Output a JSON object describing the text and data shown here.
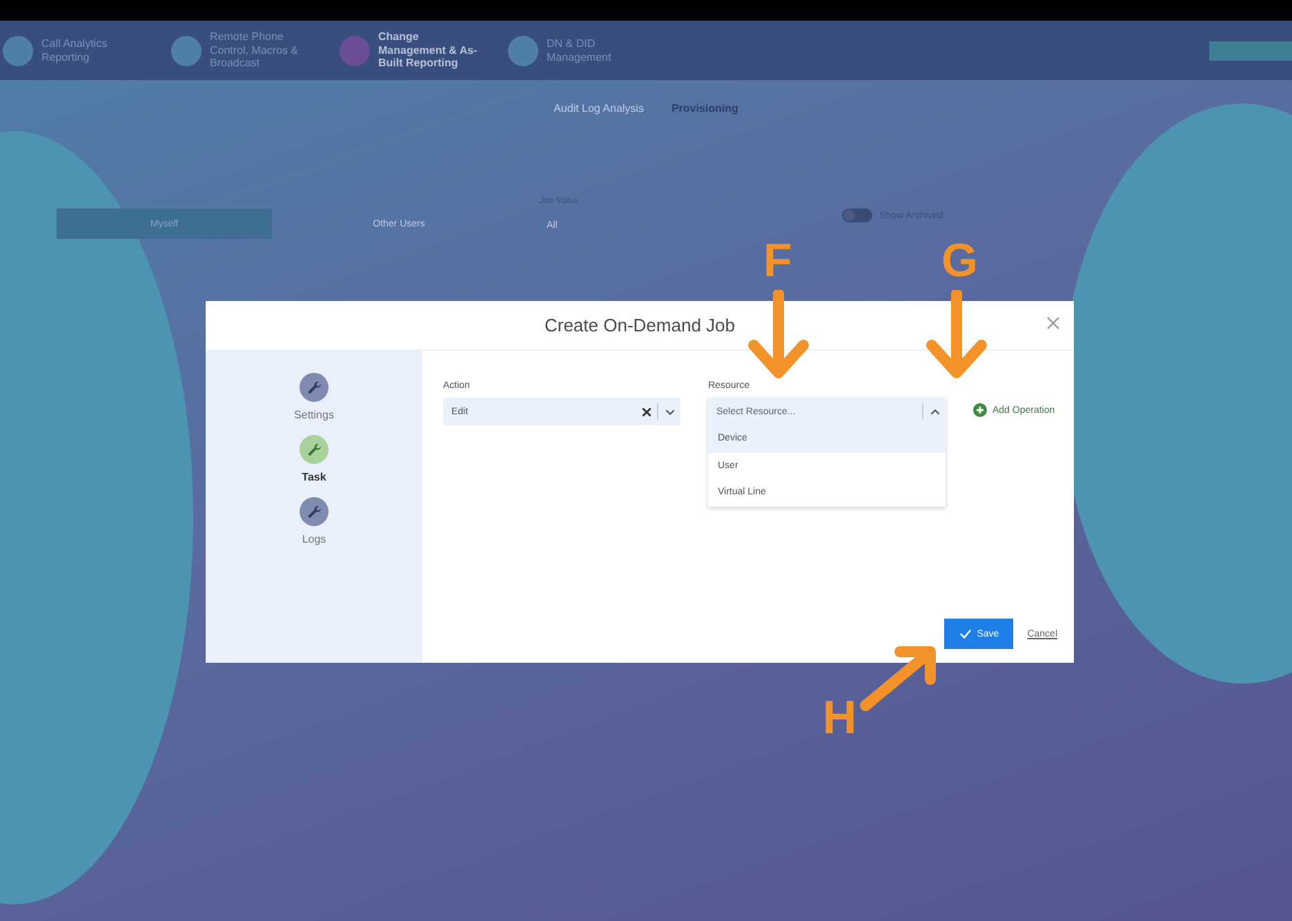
{
  "app_nav": {
    "items": [
      {
        "label": "Call Analytics Reporting",
        "selected": false
      },
      {
        "label": "Remote Phone Control, Macros & Broadcast",
        "selected": false
      },
      {
        "label": "Change Management & As-Built Reporting",
        "selected": true
      },
      {
        "label": "DN & DID Management",
        "selected": false
      }
    ]
  },
  "page_tabs": [
    {
      "label": "Audit Log Analysis",
      "selected": false
    },
    {
      "label": "Provisioning",
      "selected": true
    }
  ],
  "filters": {
    "owner_buttons": [
      {
        "label": "Myself",
        "selected": true
      },
      {
        "label": "Other Users",
        "selected": false
      }
    ],
    "job_status_label": "Job Status",
    "job_status_value": "All",
    "show_archived": {
      "label": "Show Archived",
      "on": false
    }
  },
  "dialog": {
    "title": "Create On-Demand Job",
    "steps": [
      {
        "label": "Settings",
        "selected": false
      },
      {
        "label": "Task",
        "selected": true
      },
      {
        "label": "Logs",
        "selected": false
      }
    ],
    "action": {
      "label": "Action",
      "value": "Edit"
    },
    "resource": {
      "label": "Resource",
      "placeholder": "Select Resource...",
      "expanded": true,
      "options": [
        {
          "label": "Device",
          "highlighted": true
        },
        {
          "label": "User",
          "highlighted": false
        },
        {
          "label": "Virtual Line",
          "highlighted": false
        }
      ]
    },
    "add_operation": "Add Operation",
    "save": "Save",
    "cancel": "Cancel"
  },
  "annotations": [
    {
      "letter": "F",
      "kind": "down"
    },
    {
      "letter": "G",
      "kind": "down"
    },
    {
      "letter": "H",
      "kind": "diagonal"
    }
  ]
}
